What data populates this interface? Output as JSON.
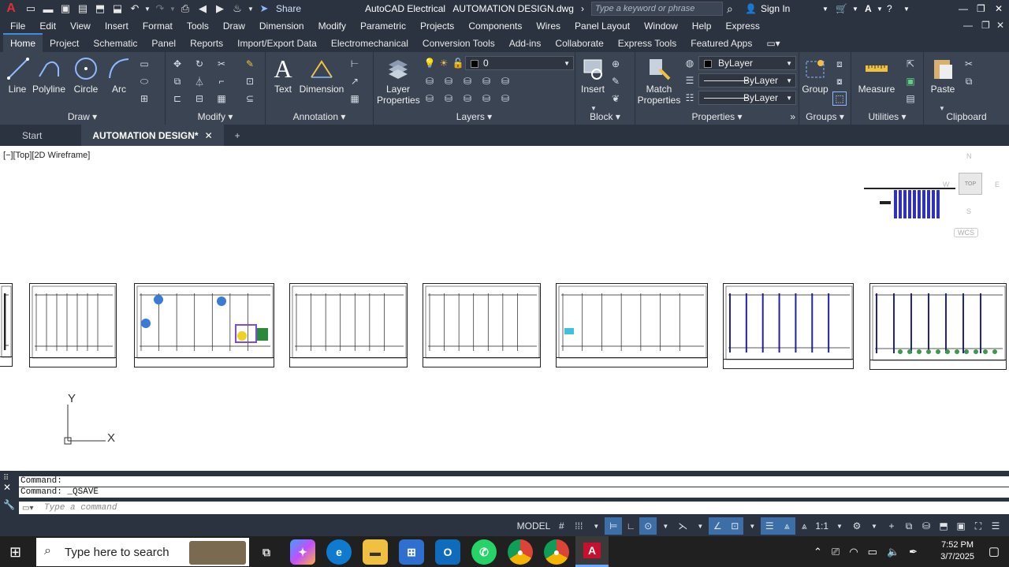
{
  "titlebar": {
    "app_logo": "A",
    "share_label": "Share",
    "title": "AutoCAD Electrical   AUTOMATION DESIGN.dwg",
    "search_placeholder": "Type a keyword or phrase",
    "sign_in": "Sign In"
  },
  "menubar": [
    "File",
    "Edit",
    "View",
    "Insert",
    "Format",
    "Tools",
    "Draw",
    "Dimension",
    "Modify",
    "Parametric",
    "Projects",
    "Components",
    "Wires",
    "Panel Layout",
    "Window",
    "Help",
    "Express"
  ],
  "ribbon_tabs": [
    "Home",
    "Project",
    "Schematic",
    "Panel",
    "Reports",
    "Import/Export Data",
    "Electromechanical",
    "Conversion Tools",
    "Add-ins",
    "Collaborate",
    "Express Tools",
    "Featured Apps"
  ],
  "ribbon": {
    "draw": {
      "title": "Draw",
      "line": "Line",
      "polyline": "Polyline",
      "circle": "Circle",
      "arc": "Arc"
    },
    "modify": {
      "title": "Modify"
    },
    "annotation": {
      "title": "Annotation",
      "text": "Text",
      "dimension": "Dimension"
    },
    "layers": {
      "title": "Layers",
      "layer_properties_1": "Layer",
      "layer_properties_2": "Properties",
      "current_layer": "0"
    },
    "block": {
      "title": "Block",
      "insert": "Insert"
    },
    "properties": {
      "title": "Properties",
      "match_1": "Match",
      "match_2": "Properties",
      "color": "ByLayer",
      "linetype": "ByLayer",
      "lineweight": "ByLayer"
    },
    "groups": {
      "title": "Groups",
      "group": "Group"
    },
    "utilities": {
      "title": "Utilities",
      "measure": "Measure"
    },
    "clipboard": {
      "title": "Clipboard",
      "paste": "Paste"
    }
  },
  "doc_tabs": {
    "start": "Start",
    "active": "AUTOMATION DESIGN*",
    "close": "✕",
    "add": "+"
  },
  "viewport": {
    "label": "[−][Top][2D Wireframe]",
    "viewcube_top": "TOP",
    "viewcube_n": "N",
    "viewcube_s": "S",
    "viewcube_w": "W",
    "viewcube_e": "E",
    "wcs": "WCS",
    "ucs_x": "X",
    "ucs_y": "Y"
  },
  "command": {
    "history_1": "Command:",
    "history_2": "Command:  _QSAVE",
    "placeholder": "Type a command"
  },
  "status": {
    "model": "MODEL",
    "scale": "1:1"
  },
  "taskbar": {
    "search": "Type here to search",
    "time": "7:52 PM",
    "date": "3/7/2025"
  },
  "colors": {
    "accent": "#3d8ee0",
    "ribbon_bg": "#3b4453",
    "chrome_bg": "#2b3340",
    "autocad_red": "#c8102e"
  }
}
